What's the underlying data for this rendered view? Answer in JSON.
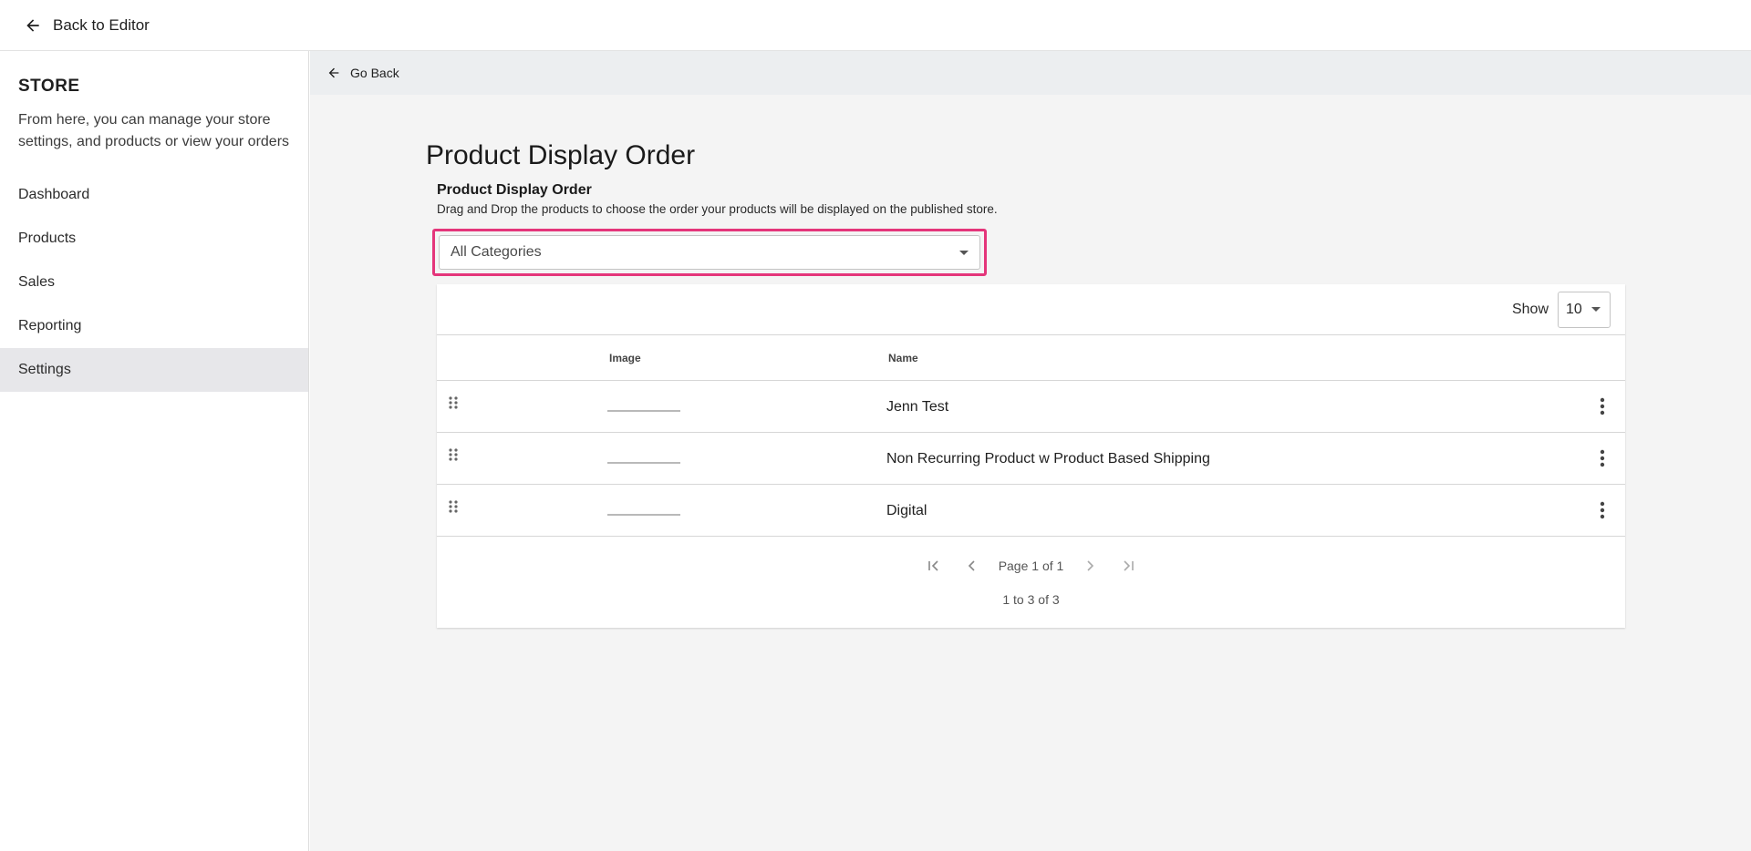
{
  "topbar": {
    "back_label": "Back to Editor"
  },
  "sidebar": {
    "title": "STORE",
    "description": "From here, you can manage your store settings, and products or view your orders",
    "items": [
      {
        "label": "Dashboard",
        "active": false
      },
      {
        "label": "Products",
        "active": false
      },
      {
        "label": "Sales",
        "active": false
      },
      {
        "label": "Reporting",
        "active": false
      },
      {
        "label": "Settings",
        "active": true
      }
    ]
  },
  "subbar": {
    "go_back_label": "Go Back"
  },
  "main": {
    "page_title": "Product Display Order",
    "section_title": "Product Display Order",
    "section_desc": "Drag and Drop the products to choose the order your products will be displayed on the published store.",
    "category_select": {
      "value": "All Categories"
    },
    "highlight_color": "#e4357a"
  },
  "table": {
    "show_label": "Show",
    "page_size": "10",
    "columns": {
      "image": "Image",
      "name": "Name"
    },
    "rows": [
      {
        "name": "Jenn Test"
      },
      {
        "name": "Non Recurring Product w Product Based Shipping"
      },
      {
        "name": "Digital"
      }
    ],
    "pagination": {
      "page_text": "Page 1 of 1",
      "range_text": "1 to 3 of 3"
    }
  },
  "icons": [
    "arrow-left-icon",
    "caret-down-icon",
    "drag-handle-icon",
    "more-vertical-icon",
    "first-page-icon",
    "prev-page-icon",
    "next-page-icon",
    "last-page-icon"
  ]
}
